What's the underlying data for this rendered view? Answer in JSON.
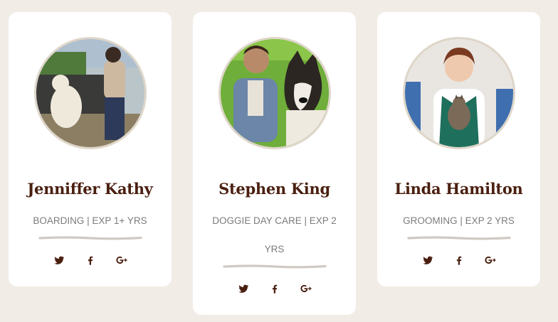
{
  "team": [
    {
      "name": "Jenniffer Kathy",
      "role": "BOARDING | EXP 1+ YRS",
      "photo": "woman-walking-dog-photo",
      "social": [
        "twitter-icon",
        "facebook-icon",
        "google-plus-icon"
      ]
    },
    {
      "name": "Stephen King",
      "role": "DOGGIE DAY CARE | EXP 2 YRS",
      "photo": "man-with-akita-dog-photo",
      "social": [
        "twitter-icon",
        "facebook-icon",
        "google-plus-icon"
      ]
    },
    {
      "name": "Linda Hamilton",
      "role": "GROOMING | EXP 2 YRS",
      "photo": "groomer-holding-cat-photo",
      "social": [
        "twitter-icon",
        "facebook-icon",
        "google-plus-icon"
      ]
    }
  ],
  "colors": {
    "background": "#f1ece6",
    "card": "#ffffff",
    "name": "#4a1f10",
    "role": "#7c7c7c",
    "avatar_border": "#ded6c9",
    "divider": "#cfcac2"
  }
}
